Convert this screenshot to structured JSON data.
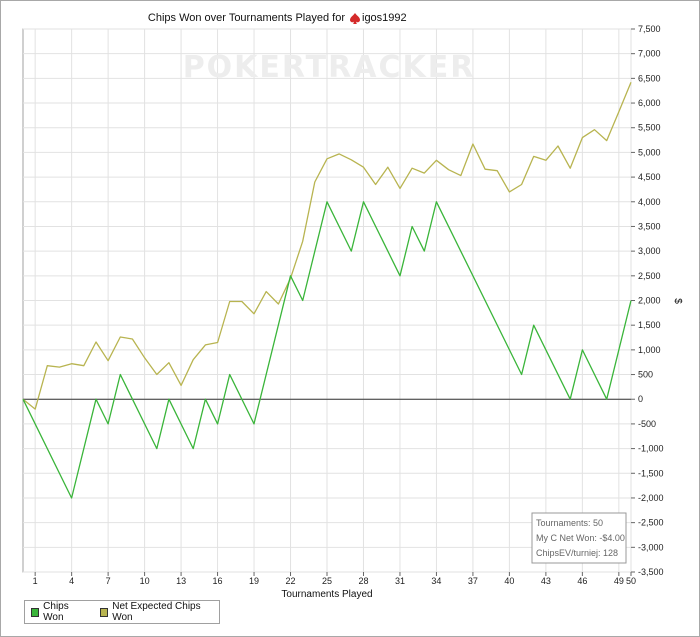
{
  "chart_data": {
    "type": "line",
    "title": "Chips Won over Tournaments Played for",
    "player_name": "igos1992",
    "player_icon": "spade-icon",
    "watermark": "POKERTRACKER",
    "xlabel": "Tournaments Played",
    "ylabel": "$",
    "xlim": [
      0,
      50
    ],
    "ylim": [
      -3500,
      7500
    ],
    "x_ticks": [
      1,
      4,
      7,
      10,
      13,
      16,
      19,
      22,
      25,
      28,
      31,
      34,
      37,
      40,
      43,
      46,
      49,
      50
    ],
    "y_ticks": [
      -3500,
      -3000,
      -2500,
      -2000,
      -1500,
      -1000,
      -500,
      0,
      500,
      1000,
      1500,
      2000,
      2500,
      3000,
      3500,
      4000,
      4500,
      5000,
      5500,
      6000,
      6500,
      7000,
      7500
    ],
    "y_tick_labels": [
      "-3,500",
      "-3,000",
      "-2,500",
      "-2,000",
      "-1,500",
      "-1,000",
      "-500",
      "0",
      "500",
      "1,000",
      "1,500",
      "2,000",
      "2,500",
      "3,000",
      "3,500",
      "4,000",
      "4,500",
      "5,000",
      "5,500",
      "6,000",
      "6,500",
      "7,000",
      "7,500"
    ],
    "grid": true,
    "legend_position": "bottom-left",
    "series": [
      {
        "name": "Chips Won",
        "color": "#3ab53a",
        "x": [
          0,
          4,
          6,
          7,
          8,
          11,
          12,
          14,
          15,
          16,
          17,
          19,
          22,
          23,
          25,
          27,
          28,
          31,
          32,
          33,
          34,
          41,
          42,
          45,
          46,
          48,
          50
        ],
        "y": [
          0,
          -2000,
          0,
          -500,
          500,
          -1000,
          0,
          -1000,
          0,
          -500,
          500,
          -500,
          2500,
          2000,
          4000,
          3000,
          4000,
          2500,
          3500,
          3000,
          4000,
          500,
          1500,
          0,
          1000,
          0,
          2000
        ]
      },
      {
        "name": "Net Expected Chips Won",
        "color": "#b8b450",
        "x": [
          0,
          1,
          2,
          3,
          4,
          5,
          6,
          7,
          8,
          9,
          10,
          11,
          12,
          13,
          14,
          15,
          16,
          17,
          18,
          19,
          20,
          21,
          22,
          23,
          24,
          25,
          26,
          27,
          28,
          29,
          30,
          31,
          32,
          33,
          34,
          35,
          36,
          37,
          38,
          39,
          40,
          41,
          42,
          43,
          44,
          45,
          46,
          47,
          48,
          49,
          50
        ],
        "y": [
          0,
          -200,
          680,
          650,
          720,
          680,
          1160,
          780,
          1260,
          1220,
          840,
          500,
          740,
          280,
          800,
          1100,
          1150,
          1980,
          1980,
          1730,
          2180,
          1930,
          2450,
          3200,
          4400,
          4870,
          4970,
          4850,
          4700,
          4350,
          4700,
          4270,
          4680,
          4580,
          4840,
          4650,
          4530,
          5170,
          4660,
          4630,
          4200,
          4350,
          4920,
          4840,
          5130,
          4680,
          5300,
          5460,
          5240,
          5820,
          6420
        ]
      }
    ],
    "stats_box": {
      "tournaments": "Tournaments: 50",
      "net_won": "My C Net Won: -$4.00",
      "chips_ev": "ChipsEV/turniej: 128"
    }
  }
}
